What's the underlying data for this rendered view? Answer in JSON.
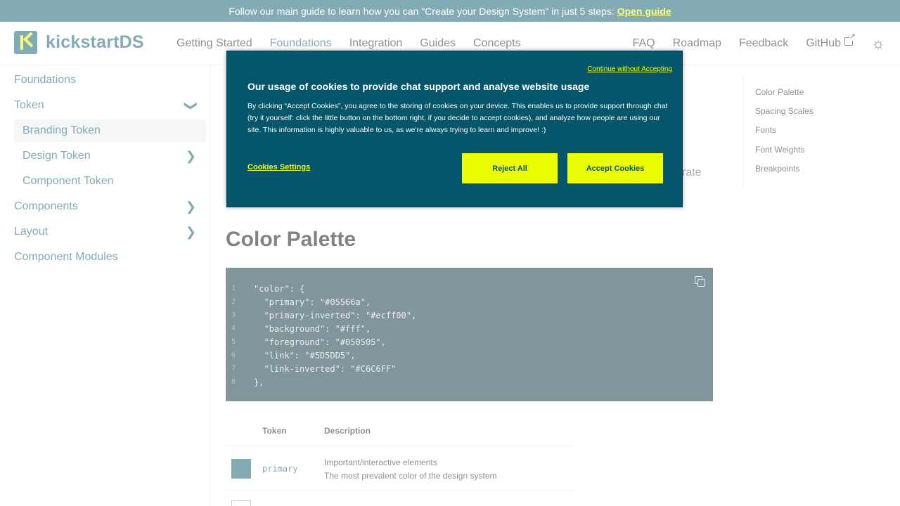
{
  "announcement": {
    "text": "Follow our main guide to learn how you can \"Create your Design System\" in just 5 steps:",
    "link": "Open guide"
  },
  "brand": {
    "name": "kickstartDS",
    "accent": "#ecff00",
    "primary": "#05566a"
  },
  "nav": {
    "left": [
      "Getting Started",
      "Foundations",
      "Integration",
      "Guides",
      "Concepts"
    ],
    "right": [
      "FAQ",
      "Roadmap",
      "Feedback",
      "GitHub"
    ]
  },
  "sidebar": {
    "items": [
      {
        "label": "Foundations"
      },
      {
        "label": "Token"
      },
      {
        "label": "Branding Token"
      },
      {
        "label": "Design Token"
      },
      {
        "label": "Component Token"
      },
      {
        "label": "Components"
      },
      {
        "label": "Layout"
      },
      {
        "label": "Component Modules"
      }
    ]
  },
  "content": {
    "partial_text": "rate",
    "section_title": "Color Palette",
    "code_lines": [
      "\"color\": {",
      "  \"primary\": \"#05566a\",",
      "  \"primary-inverted\": \"#ecff00\",",
      "  \"background\": \"#fff\",",
      "  \"foreground\": \"#050505\",",
      "  \"link\": \"#5D5DD5\",",
      "  \"link-inverted\": \"#C6C6FF\"",
      "},"
    ],
    "line_numbers": [
      "1",
      "2",
      "3",
      "4",
      "5",
      "6",
      "7",
      "8"
    ],
    "table": {
      "headers": {
        "token": "Token",
        "description": "Description"
      },
      "rows": [
        {
          "token": "primary",
          "desc_1": "Important/interactive elements",
          "desc_2": "The most prevalent color of the design system"
        }
      ]
    }
  },
  "toc": [
    "Color Palette",
    "Spacing Scales",
    "Fonts",
    "Font Weights",
    "Breakpoints"
  ],
  "cookie": {
    "continue": "Continue without Accepting",
    "title": "Our usage of cookies to provide chat support and analyse website usage",
    "body": "By clicking “Accept Cookies”, you agree to the storing of cookies on your device. This enables us to provide support through chat (try it yourself: click the little button on the bottom right, if you decide to accept cookies), and analyze how people are using our site. This information is highly valuable to us, as we're always trying to learn and improve! :)",
    "settings": "Cookies Settings",
    "reject": "Reject All",
    "accept": "Accept Cookies"
  }
}
